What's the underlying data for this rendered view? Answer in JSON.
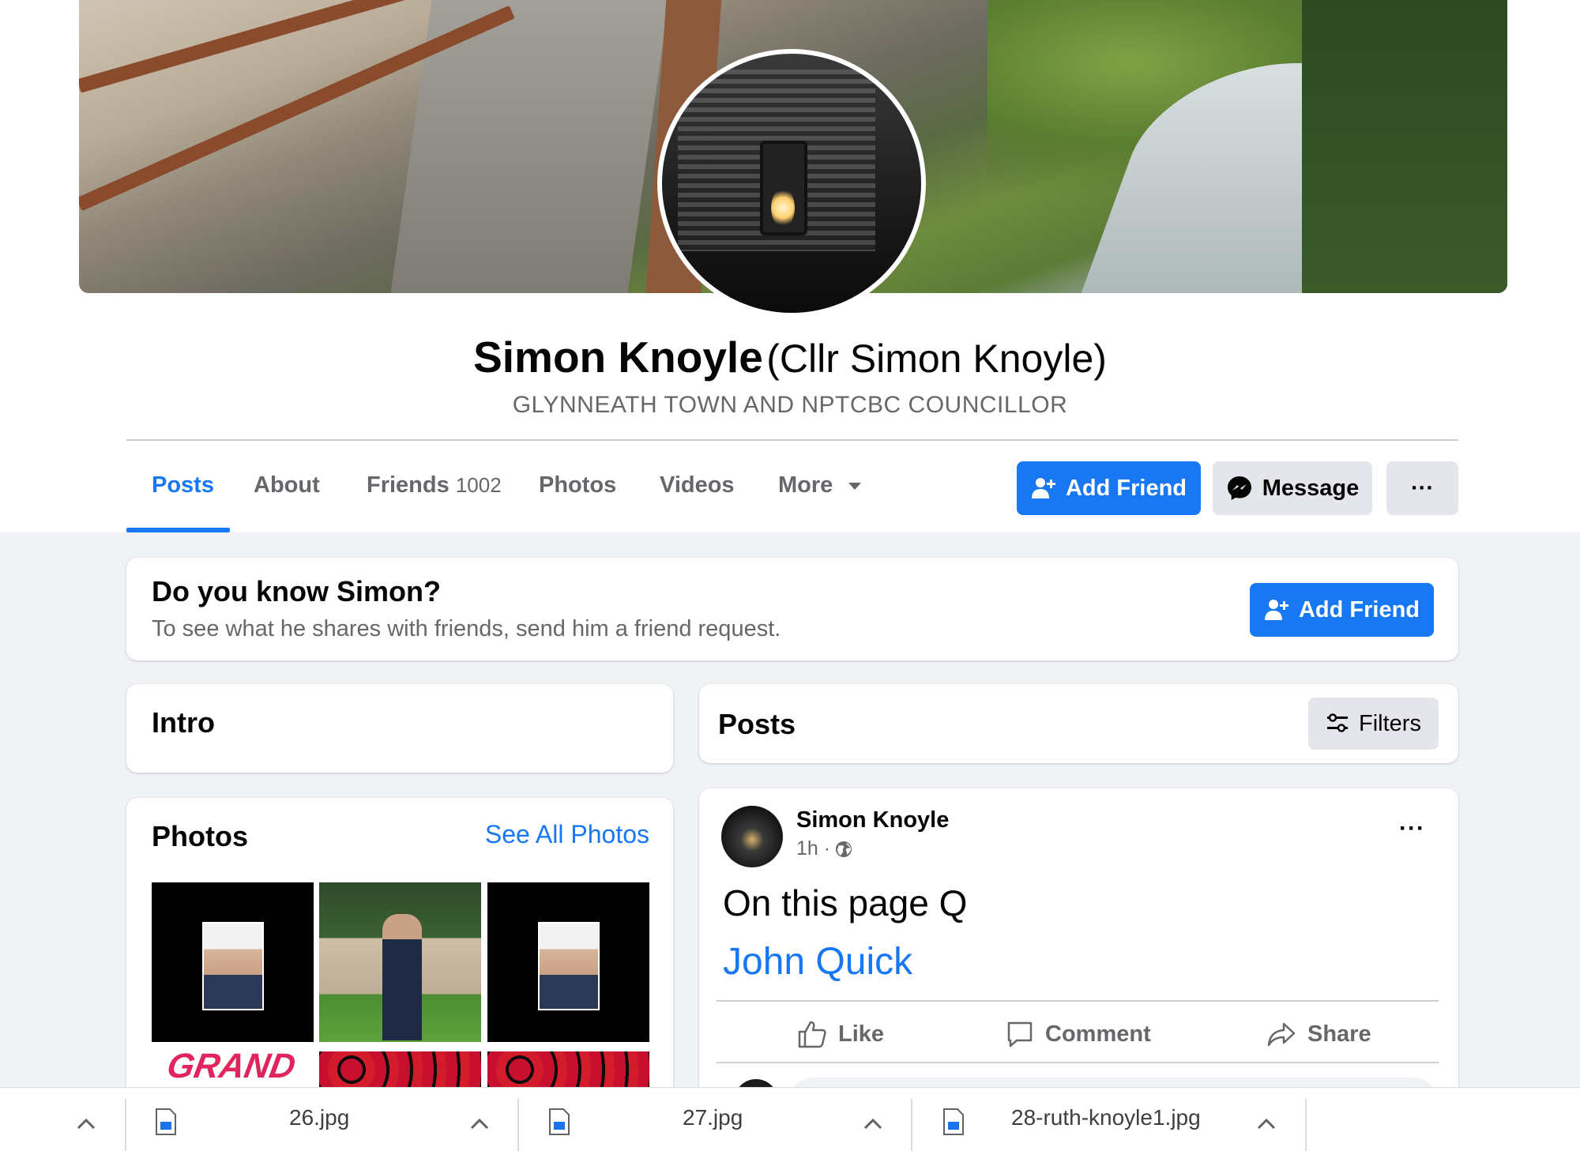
{
  "profile": {
    "name": "Simon Knoyle",
    "alt_name": "(Cllr Simon Knoyle)",
    "subtitle": "GLYNNEATH TOWN AND NPTCBC COUNCILLOR"
  },
  "tabs": [
    {
      "label": "Posts",
      "active": true
    },
    {
      "label": "About"
    },
    {
      "label": "Friends",
      "count": "1002"
    },
    {
      "label": "Photos"
    },
    {
      "label": "Videos"
    },
    {
      "label": "More"
    }
  ],
  "actions": {
    "add_friend": "Add Friend",
    "message": "Message",
    "more": "···"
  },
  "know_card": {
    "title": "Do you know Simon?",
    "subtitle": "To see what he shares with friends, send him a friend request.",
    "button": "Add Friend"
  },
  "intro": {
    "title": "Intro"
  },
  "photos": {
    "title": "Photos",
    "see_all": "See All Photos",
    "partial_text": "GRAND"
  },
  "posts_header": {
    "title": "Posts",
    "filters": "Filters"
  },
  "post": {
    "author": "Simon Knoyle",
    "time": "1h ·",
    "more": "···",
    "text": "On this page Q",
    "link": "John Quick",
    "like": "Like",
    "comment": "Comment",
    "share": "Share"
  },
  "downloads": [
    {
      "name": "26.jpg"
    },
    {
      "name": "27.jpg"
    },
    {
      "name": "28-ruth-knoyle1.jpg"
    }
  ],
  "colors": {
    "accent": "#1877f2",
    "background": "#f0f2f5",
    "secondary_button": "#e4e6eb",
    "muted_text": "#65676b"
  }
}
